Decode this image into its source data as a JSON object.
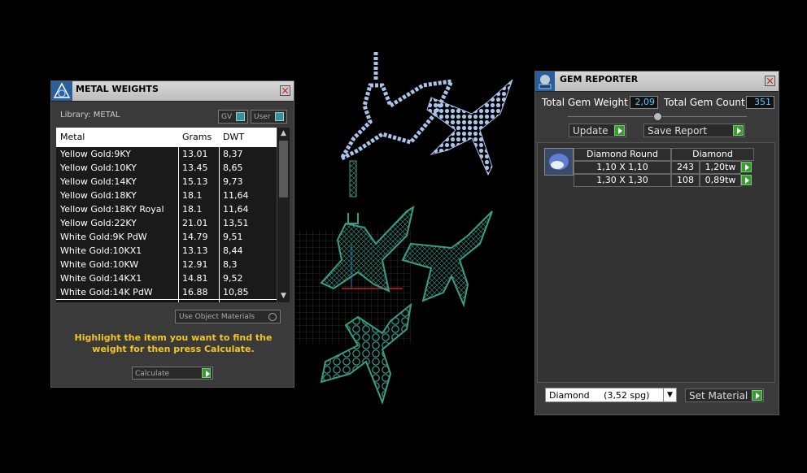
{
  "metal_weights": {
    "title": "METAL WEIGHTS",
    "library_label": "Library: METAL",
    "gv_label": "GV",
    "user_label": "User",
    "columns": [
      "Metal",
      "Grams",
      "DWT"
    ],
    "rows": [
      [
        "Yellow Gold:9KY",
        "13.01",
        "8,37"
      ],
      [
        "Yellow Gold:10KY",
        "13.45",
        "8,65"
      ],
      [
        "Yellow Gold:14KY",
        "15.13",
        "9,73"
      ],
      [
        "Yellow Gold:18KY",
        "18.1",
        "11,64"
      ],
      [
        "Yellow Gold:18KY Royal",
        "18.1",
        "11,64"
      ],
      [
        "Yellow Gold:22KY",
        "21.01",
        "13,51"
      ],
      [
        "White Gold:9K PdW",
        "14.79",
        "9,51"
      ],
      [
        "White Gold:10KX1",
        "13.13",
        "8,44"
      ],
      [
        "White Gold:10KW",
        "12.91",
        "8,3"
      ],
      [
        "White Gold:14KX1",
        "14.81",
        "9,52"
      ],
      [
        "White Gold:14K PdW",
        "16.88",
        "10,85"
      ]
    ],
    "use_object_materials": "Use Object Materials",
    "instruction": "Highlight the item you want to find the weight for then press Calculate.",
    "calculate_label": "Calculate"
  },
  "gem_reporter": {
    "title": "GEM REPORTER",
    "total_weight_label": "Total Gem Weight",
    "total_weight_value": "2,09",
    "total_count_label": "Total Gem Count",
    "total_count_value": "351",
    "update_label": "Update",
    "save_report_label": "Save Report",
    "gem_header_type": "Diamond Round",
    "gem_header_material": "Diamond",
    "gem_rows": [
      {
        "size": "1,10 X 1,10",
        "count": "243",
        "weight": "1,20tw"
      },
      {
        "size": "1,30 X 1,30",
        "count": "108",
        "weight": "0,89tw"
      }
    ],
    "material_select": "Diamond     (3,52 spg)",
    "set_material_label": "Set Material"
  },
  "colors": {
    "gem_blue": "#a9c3ea",
    "mesh_green": "#3b9c84",
    "accent_yellow": "#f3c623",
    "field_blue": "#5bc8ff"
  }
}
